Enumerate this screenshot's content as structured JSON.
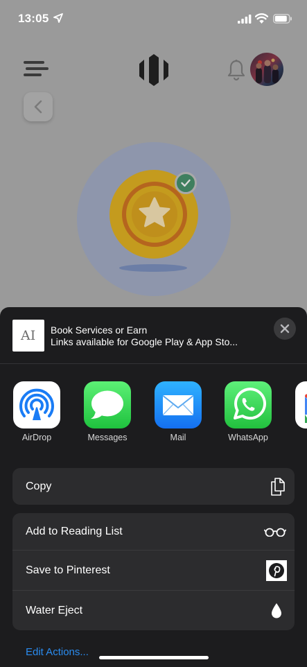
{
  "status_bar": {
    "time": "13:05"
  },
  "share_sheet": {
    "doc_thumb_glyph": "AI",
    "title": "Book Services or Earn",
    "subtitle": "Links available for Google Play & App Sto...",
    "apps": [
      {
        "label": "AirDrop",
        "icon": "airdrop-icon"
      },
      {
        "label": "Messages",
        "icon": "messages-icon"
      },
      {
        "label": "Mail",
        "icon": "mail-icon"
      },
      {
        "label": "WhatsApp",
        "icon": "whatsapp-icon"
      }
    ],
    "copy_label": "Copy",
    "actions": [
      {
        "label": "Add to Reading List",
        "icon": "glasses-icon"
      },
      {
        "label": "Save to Pinterest",
        "icon": "pinterest-icon"
      },
      {
        "label": "Water Eject",
        "icon": "water-drop-icon"
      }
    ],
    "edit_actions": "Edit Actions..."
  },
  "colors": {
    "sheet_bg": "#1c1c1e",
    "row_bg": "#2c2c2e",
    "link": "#2a8cf0",
    "coin_gold": "#c49b1e",
    "check_green": "#3f7f5e"
  }
}
